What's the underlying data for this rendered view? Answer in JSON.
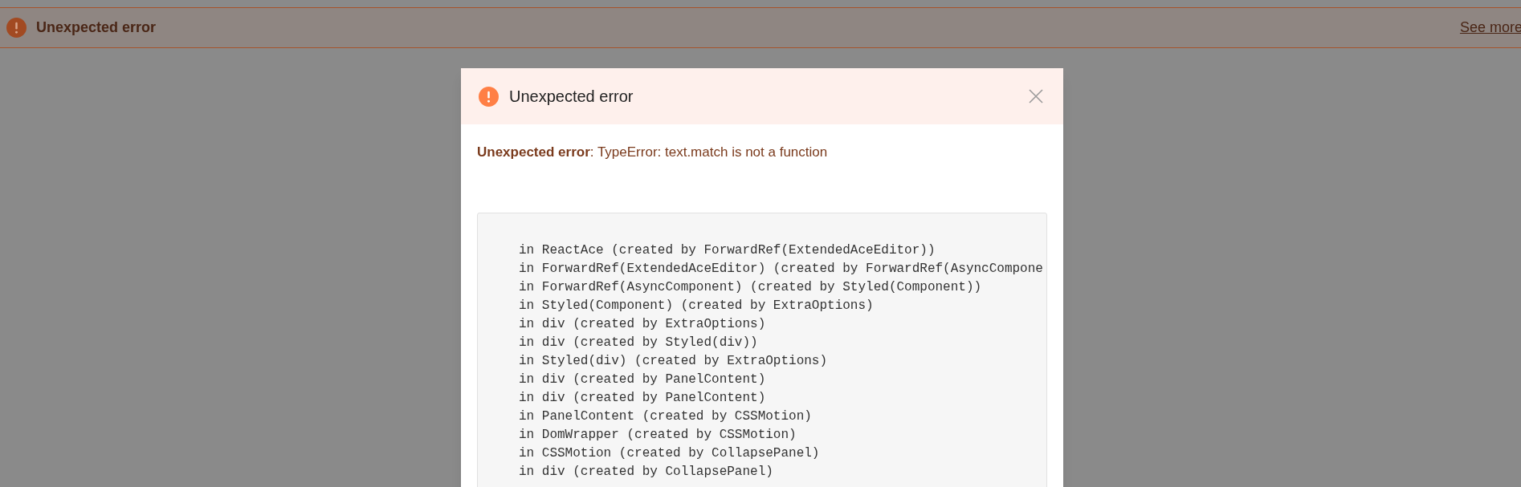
{
  "banner": {
    "title": "Unexpected error",
    "link": "See more"
  },
  "dialog": {
    "title": "Unexpected error",
    "message": "**Unexpected error**: TypeError: text.match is not a function",
    "stack_lines": [
      "in ReactAce (created by ForwardRef(ExtendedAceEditor))",
      "in ForwardRef(ExtendedAceEditor) (created by ForwardRef(AsyncCompone",
      "in ForwardRef(AsyncComponent) (created by Styled(Component))",
      "in Styled(Component) (created by ExtraOptions)",
      "in div (created by ExtraOptions)",
      "in div (created by Styled(div))",
      "in Styled(div) (created by ExtraOptions)",
      "in div (created by PanelContent)",
      "in div (created by PanelContent)",
      "in PanelContent (created by CSSMotion)",
      "in DomWrapper (created by CSSMotion)",
      "in CSSMotion (created by CollapsePanel)",
      "in div (created by CollapsePanel)"
    ]
  }
}
